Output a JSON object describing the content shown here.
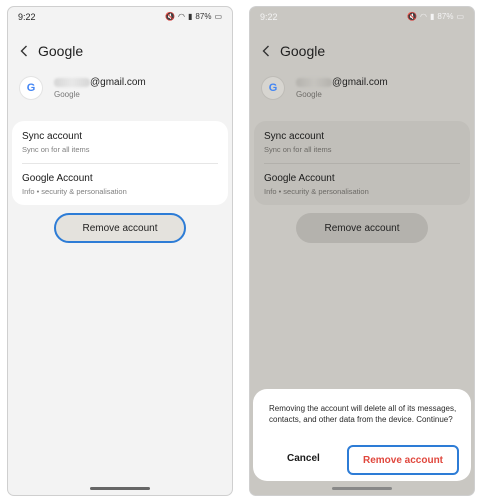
{
  "status": {
    "time": "9:22",
    "battery": "87%"
  },
  "header": {
    "title": "Google"
  },
  "account": {
    "email_suffix": "@gmail.com",
    "provider": "Google"
  },
  "menu": {
    "sync_title": "Sync account",
    "sync_sub": "Sync on for all items",
    "google_title": "Google Account",
    "google_sub": "Info  •  security & personalisation"
  },
  "remove_label": "Remove account",
  "dialog": {
    "message": "Removing the account will delete all of its messages, contacts, and other data from the device. Continue?",
    "cancel": "Cancel",
    "remove": "Remove account"
  },
  "colors": {
    "accent": "#2d7cd6",
    "danger": "#e0473d",
    "google_blue": "#4285f4"
  }
}
